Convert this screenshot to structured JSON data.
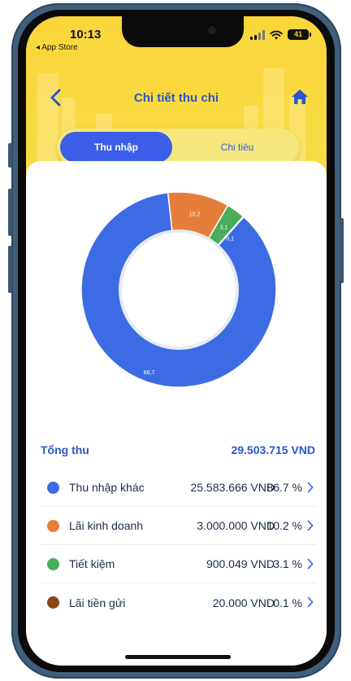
{
  "status_bar": {
    "time": "10:13",
    "back_app": "◂ App Store",
    "battery": "41"
  },
  "nav": {
    "title": "Chi tiết thu chi",
    "back_icon": "chevron-left-icon",
    "home_icon": "home-icon"
  },
  "tabs": [
    {
      "label": "Thu nhập",
      "active": true
    },
    {
      "label": "Chi tiêu",
      "active": false
    }
  ],
  "chart_data": {
    "type": "pie",
    "donut": true,
    "categories": [
      "Thu nhập khác",
      "Lãi kinh doanh",
      "Tiết kiệm",
      "Lãi tiền gửi"
    ],
    "values": [
      86.7,
      10.2,
      3.1,
      0.1
    ],
    "slice_labels": [
      "86,7",
      "10,2",
      "3,1",
      "0,1"
    ],
    "colors": [
      "#3d6be4",
      "#e67e3b",
      "#49ad5c",
      "#8a4516"
    ]
  },
  "summary": {
    "label": "Tổng thu",
    "value": "29.503.715 VND"
  },
  "items": [
    {
      "name": "Thu nhập khác",
      "amount": "25.583.666 VND",
      "pct": "86.7 %",
      "color": "#3d6be4"
    },
    {
      "name": "Lãi kinh doanh",
      "amount": "3.000.000 VND",
      "pct": "10.2 %",
      "color": "#e67e3b"
    },
    {
      "name": "Tiết kiệm",
      "amount": "900.049 VND",
      "pct": "3.1 %",
      "color": "#49ad5c"
    },
    {
      "name": "Lãi tiền gửi",
      "amount": "20.000 VND",
      "pct": "0.1 %",
      "color": "#8a4516"
    }
  ]
}
